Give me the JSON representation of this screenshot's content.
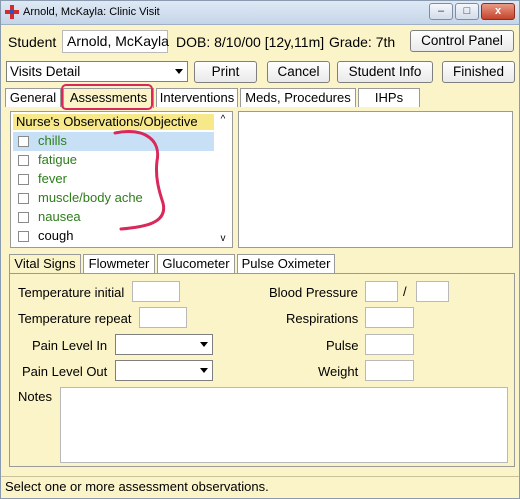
{
  "window": {
    "title": "Arnold, McKayla: Clinic Visit",
    "controls": {
      "minimize": "–",
      "restore": "□",
      "close": "x"
    }
  },
  "header": {
    "student_label": "Student",
    "student_name": "Arnold, McKayla",
    "dob": "DOB: 8/10/00 [12y,11m]",
    "grade": "Grade: 7th",
    "control_panel_label": "Control Panel"
  },
  "toolbar": {
    "view_select_value": "Visits Detail",
    "print_label": "Print",
    "cancel_label": "Cancel",
    "student_info_label": "Student Info",
    "finished_label": "Finished"
  },
  "tabs": [
    {
      "label": "General"
    },
    {
      "label": "Assessments"
    },
    {
      "label": "Interventions"
    },
    {
      "label": "Meds, Procedures"
    },
    {
      "label": "IHPs"
    }
  ],
  "observations": {
    "header": "Nurse's Observations/Objective",
    "scroll_up": "^",
    "scroll_down": "v",
    "items": [
      {
        "label": "chills"
      },
      {
        "label": "fatigue"
      },
      {
        "label": "fever"
      },
      {
        "label": "muscle/body ache"
      },
      {
        "label": "nausea"
      },
      {
        "label": "cough"
      }
    ]
  },
  "vitals_tabs": [
    {
      "label": "Vital Signs"
    },
    {
      "label": "Flowmeter"
    },
    {
      "label": "Glucometer"
    },
    {
      "label": "Pulse Oximeter"
    }
  ],
  "vitals": {
    "temperature_initial_label": "Temperature initial",
    "temperature_repeat_label": "Temperature repeat",
    "pain_level_in_label": "Pain Level In",
    "pain_level_out_label": "Pain Level Out",
    "blood_pressure_label": "Blood Pressure",
    "bp_separator": "/",
    "respirations_label": "Respirations",
    "pulse_label": "Pulse",
    "weight_label": "Weight",
    "notes_label": "Notes"
  },
  "status_text": "Select one or more assessment observations.",
  "colors": {
    "window_background": "#fbf4c8",
    "checked_item_text": "#2d7d1b",
    "selected_row": "#c8e0f6",
    "annotation": "#d9285a"
  }
}
